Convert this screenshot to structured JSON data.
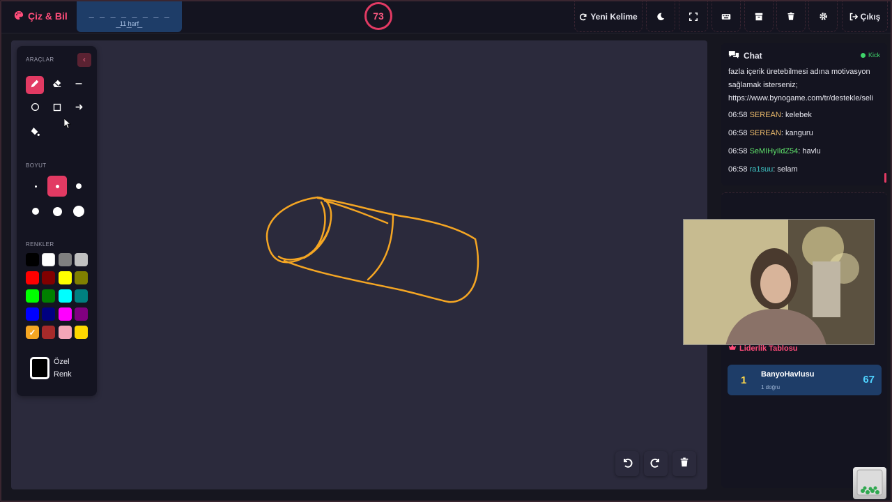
{
  "app": {
    "name": "Çiz & Bil",
    "accent": "#e23a63"
  },
  "word": {
    "mask": "_ _ _ _ _ _ _ _ _ _ _",
    "hint": "11 harf"
  },
  "timer": {
    "value": "73"
  },
  "toolbar": {
    "new_word_label": "Yeni Kelime",
    "exit_label": "Çıkış",
    "icons": [
      "refresh-icon",
      "moon-icon",
      "fullscreen-icon",
      "keyboard-icon",
      "archive-icon",
      "trash-icon",
      "gear-icon",
      "logout-icon"
    ]
  },
  "tools": {
    "title": "ARAÇLAR",
    "items": [
      "pencil",
      "eraser",
      "line",
      "circle",
      "rectangle",
      "arrow",
      "fill"
    ],
    "active": "pencil"
  },
  "sizes": {
    "title": "BOYUT",
    "active_index": 1,
    "count": 6
  },
  "colors": {
    "title": "RENKLER",
    "swatches": [
      "#000000",
      "#ffffff",
      "#808080",
      "#c0c0c0",
      "#ff0000",
      "#800000",
      "#ffff00",
      "#808000",
      "#00ff00",
      "#008000",
      "#00ffff",
      "#008080",
      "#0000ff",
      "#000080",
      "#ff00ff",
      "#800080",
      "#f5a623",
      "#a52a2a",
      "#f4a6b8",
      "#ffd700"
    ],
    "selected": "#f5a623",
    "custom_label": "Özel Renk"
  },
  "drawing": {
    "stroke_color": "#f5a623"
  },
  "chat": {
    "title": "Chat",
    "platform": "Kick",
    "intro": [
      "fazla içerik üretebilmesi adına motivasyon",
      "sağlamak isterseniz;",
      "https://www.bynogame.com/tr/destekle/seli"
    ],
    "messages": [
      {
        "time": "06:58",
        "user": "SEREAN",
        "color": "#e8b86a",
        "text": ": kelebek"
      },
      {
        "time": "06:58",
        "user": "SEREAN",
        "color": "#e8b86a",
        "text": ": kanguru"
      },
      {
        "time": "06:58",
        "user": "SeMIHyIldZ54",
        "color": "#5fe36b",
        "text": ": havlu"
      },
      {
        "time": "06:58",
        "user": "ra1suu",
        "color": "#3fc8c8",
        "text": ": selam"
      }
    ]
  },
  "leaderboard": {
    "title": "Liderlik Tablosu",
    "rows": [
      {
        "rank": "1",
        "name": "BanyoHavlusu",
        "sub": "1 doğru",
        "score": "67"
      }
    ]
  }
}
